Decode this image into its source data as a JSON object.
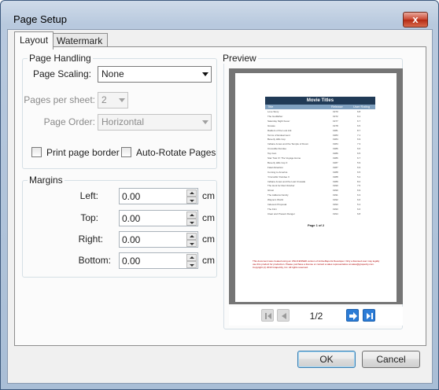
{
  "window": {
    "title": "Page Setup",
    "close_glyph": "x"
  },
  "tabs": [
    {
      "label": "Layout",
      "active": true
    },
    {
      "label": "Watermark",
      "active": false
    }
  ],
  "page_handling": {
    "group_label": "Page Handling",
    "page_scaling_label": "Page Scaling:",
    "page_scaling_value": "None",
    "pages_per_sheet_label": "Pages per sheet:",
    "pages_per_sheet_value": "2",
    "page_order_label": "Page Order:",
    "page_order_value": "Horizontal",
    "print_page_border_label": "Print page border",
    "print_page_border_checked": false,
    "auto_rotate_label": "Auto-Rotate Pages",
    "auto_rotate_checked": false
  },
  "margins": {
    "group_label": "Margins",
    "unit": "cm",
    "fields": [
      {
        "label": "Left:",
        "value": "0.00"
      },
      {
        "label": "Top:",
        "value": "0.00"
      },
      {
        "label": "Right:",
        "value": "0.00"
      },
      {
        "label": "Bottom:",
        "value": "0.00"
      }
    ]
  },
  "preview": {
    "group_label": "Preview",
    "page_indicator": "1/2",
    "document": {
      "title": "Movie Titles",
      "columns": [
        "Title",
        "Release",
        "User Rating"
      ],
      "rows": [
        [
          "Love Story",
          "1970",
          "6.8"
        ],
        [
          "The Godfather",
          "1972",
          "9.1"
        ],
        [
          "Saturday Night Fever",
          "1977",
          "6.7"
        ],
        [
          "Grease",
          "1978",
          "6.5"
        ],
        [
          "Raiders of the Lost Ark",
          "1981",
          "8.7"
        ],
        [
          "Terms of Endearment",
          "1983",
          "7.1"
        ],
        [
          "Beverly Hills Cop",
          "1984",
          "6.9"
        ],
        [
          "Indiana Jones and the Temple of Doom",
          "1984",
          "7.3"
        ],
        [
          "Crocodile Dundee",
          "1986",
          "6.6"
        ],
        [
          "Top Gun",
          "1986",
          "6.5"
        ],
        [
          "Star Trek IV: The Voyage Home",
          "1986",
          "6.7"
        ],
        [
          "Beverly Hills Cop II",
          "1987",
          "5.9"
        ],
        [
          "Fatal Attraction",
          "1987",
          "6.9"
        ],
        [
          "Coming to America",
          "1988",
          "6.5"
        ],
        [
          "'Crocodile' Dundee II",
          "1988",
          "5.2"
        ],
        [
          "Indiana Jones and the Last Crusade",
          "1989",
          "8.2"
        ],
        [
          "The Hunt for Red October",
          "1990",
          "7.5"
        ],
        [
          "Ghost",
          "1990",
          "6.9"
        ],
        [
          "The Addams Family",
          "1991",
          "6.3"
        ],
        [
          "Wayne's World",
          "1992",
          "6.6"
        ],
        [
          "Indecent Proposal",
          "1993",
          "5.4"
        ],
        [
          "The Firm",
          "1993",
          "6.6"
        ],
        [
          "Clear and Present Danger",
          "1994",
          "6.8"
        ]
      ],
      "page_number": "Page 1 of 2",
      "notice": "This document was created using an UNLICENSED version of ActiveReports Developer. Only a licensed user may legally use this product for production. Please purchase a license or contact a sales representative at sales@grapecity.com. Copyright (c) 2013 GrapeCity, Inc. All rights reserved."
    }
  },
  "buttons": {
    "ok": "OK",
    "cancel": "Cancel"
  },
  "colors": {
    "table_title_bg": "#203a56",
    "table_header_bg": "#7fa0bf",
    "notice_text": "#b00000",
    "nav_active": "#2c7cd6"
  },
  "icons": {
    "first_page": "first-page-icon",
    "prev_page": "prev-page-icon",
    "next_page": "next-page-icon",
    "last_page": "last-page-icon"
  }
}
